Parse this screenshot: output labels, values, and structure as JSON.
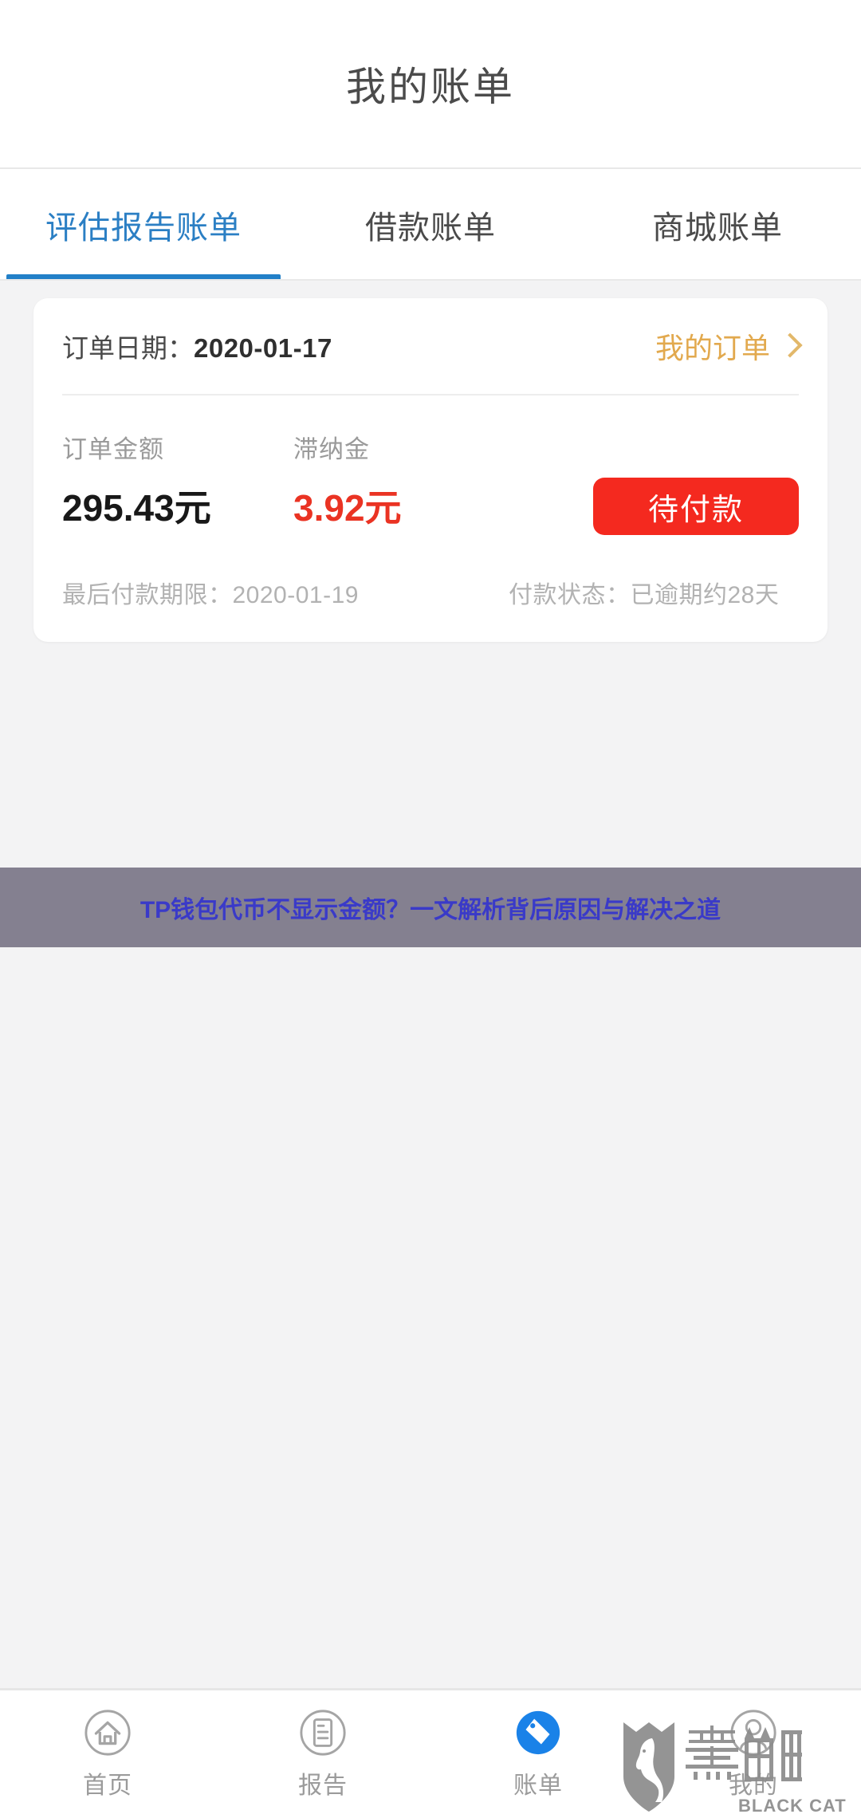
{
  "header": {
    "title": "我的账单"
  },
  "tabs": [
    {
      "label": "评估报告账单",
      "active": true
    },
    {
      "label": "借款账单",
      "active": false
    },
    {
      "label": "商城账单",
      "active": false
    }
  ],
  "order_card": {
    "date_label": "订单日期：",
    "date_value": "2020-01-17",
    "my_orders_link": "我的订单",
    "chevron_icon": "chevron-right-icon",
    "principal_label": "订单金额",
    "principal_value": "295.43元",
    "late_fee_label": "滞纳金",
    "late_fee_value": "3.92元",
    "pay_button_label": "待付款",
    "due_date_text": "最后付款期限：2020-01-19",
    "pay_status_text": "付款状态：已逾期约28天"
  },
  "ad_banner": {
    "text": "TP钱包代币不显示金额？一文解析背后原因与解决之道"
  },
  "bottom_nav": [
    {
      "label": "首页",
      "icon": "home-circle-icon",
      "active": false
    },
    {
      "label": "报告",
      "icon": "document-circle-icon",
      "active": false
    },
    {
      "label": "账单",
      "icon": "tag-circle-icon",
      "active": true
    },
    {
      "label": "我的",
      "icon": "person-circle-icon",
      "active": false
    }
  ],
  "watermark": {
    "brand_cn": "黑猫",
    "brand_en": "BLACK CAT",
    "icon": "cat-shield-icon"
  },
  "colors": {
    "accent_blue": "#2280c8",
    "nav_active_blue": "#1a82e8",
    "orange_link": "#e2a94e",
    "red_button": "#f4291f",
    "red_text": "#ea3323",
    "page_bg": "#f3f3f4",
    "banner_bg": "#848090",
    "banner_text": "#3a3ac8"
  }
}
